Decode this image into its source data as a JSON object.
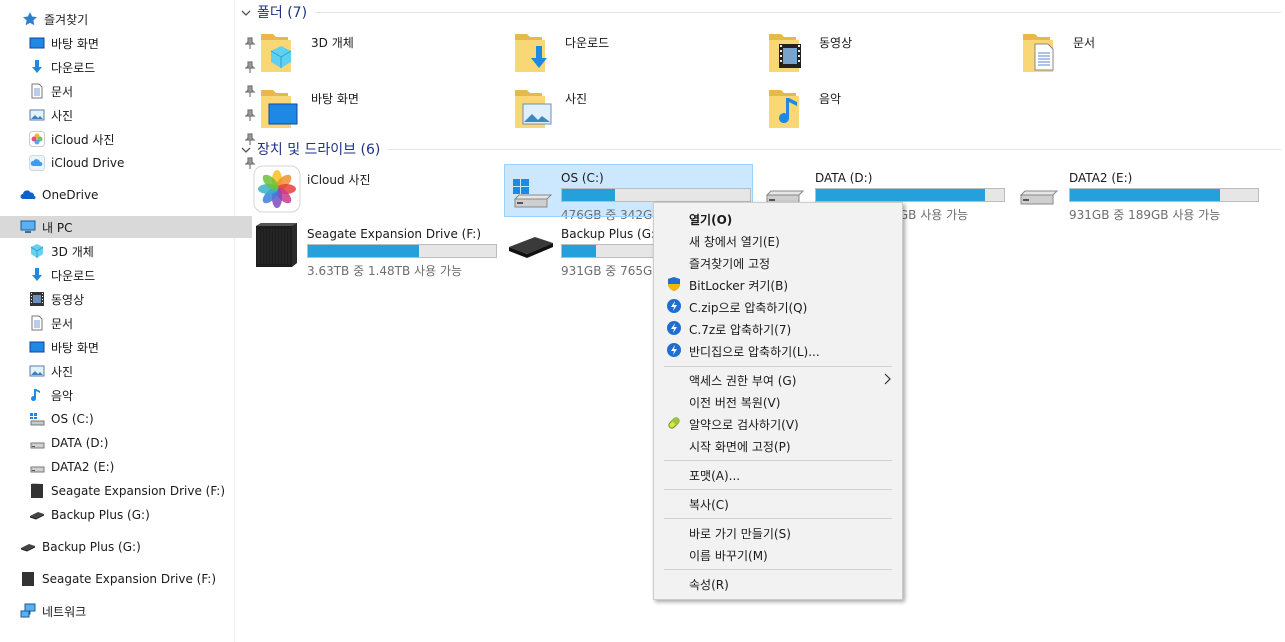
{
  "sidebar": {
    "favorites": "즐겨찾기",
    "quick": [
      {
        "label": "바탕 화면",
        "icon": "desktop-icon"
      },
      {
        "label": "다운로드",
        "icon": "download-icon"
      },
      {
        "label": "문서",
        "icon": "document-icon"
      },
      {
        "label": "사진",
        "icon": "pictures-icon"
      },
      {
        "label": "iCloud 사진",
        "icon": "icloud-photos-icon"
      },
      {
        "label": "iCloud Drive",
        "icon": "icloud-drive-icon"
      }
    ],
    "onedrive": "OneDrive",
    "thispc": "내 PC",
    "pc_items": [
      {
        "label": "3D 개체",
        "icon": "3d-objects-icon"
      },
      {
        "label": "다운로드",
        "icon": "download-icon"
      },
      {
        "label": "동영상",
        "icon": "videos-icon"
      },
      {
        "label": "문서",
        "icon": "document-icon"
      },
      {
        "label": "바탕 화면",
        "icon": "desktop-icon"
      },
      {
        "label": "사진",
        "icon": "pictures-icon"
      },
      {
        "label": "음악",
        "icon": "music-icon"
      },
      {
        "label": "OS (C:)",
        "icon": "os-drive-icon"
      },
      {
        "label": "DATA (D:)",
        "icon": "drive-icon"
      },
      {
        "label": "DATA2 (E:)",
        "icon": "drive-icon"
      },
      {
        "label": "Seagate Expansion Drive (F:)",
        "icon": "external-drive-icon"
      },
      {
        "label": "Backup Plus (G:)",
        "icon": "portable-drive-icon"
      }
    ],
    "backup": "Backup Plus (G:)",
    "seagate": "Seagate Expansion Drive (F:)",
    "network": "네트워크"
  },
  "main": {
    "folders_header": "폴더 (7)",
    "folders": [
      {
        "label": "3D 개체",
        "icon": "3d-objects-folder-icon"
      },
      {
        "label": "다운로드",
        "icon": "downloads-folder-icon"
      },
      {
        "label": "동영상",
        "icon": "videos-folder-icon"
      },
      {
        "label": "문서",
        "icon": "documents-folder-icon"
      },
      {
        "label": "바탕 화면",
        "icon": "desktop-folder-icon"
      },
      {
        "label": "사진",
        "icon": "pictures-folder-icon"
      },
      {
        "label": "음악",
        "icon": "music-folder-icon"
      }
    ],
    "devices_header": "장치 및 드라이브 (6)",
    "icloud": "iCloud 사진",
    "drives": [
      {
        "name": "OS (C:)",
        "free": "476GB 중 342GB 사용 가능",
        "used": 0.28
      },
      {
        "name": "DATA (D:)",
        "free": "1.81TB 중 185GB 사용 가능",
        "used": 0.9
      },
      {
        "name": "DATA2 (E:)",
        "free": "931GB 중 189GB 사용 가능",
        "used": 0.8
      },
      {
        "name": "Seagate Expansion Drive (F:)",
        "free": "3.63TB 중 1.48TB 사용 가능",
        "used": 0.59
      },
      {
        "name": "Backup Plus (G:)",
        "free": "931GB 중 765GB 사용 가능",
        "used": 0.18
      }
    ]
  },
  "context_menu": [
    {
      "label": "열기(O)"
    },
    {
      "label": "새 창에서 열기(E)"
    },
    {
      "label": "즐겨찾기에 고정"
    },
    {
      "label": "BitLocker 켜기(B)"
    },
    {
      "label": "C.zip으로 압축하기(Q)"
    },
    {
      "label": "C.7z로 압축하기(7)"
    },
    {
      "label": "반디집으로 압축하기(L)..."
    },
    {
      "label": "액세스 권한 부여 (G)"
    },
    {
      "label": "이전 버전 복원(V)"
    },
    {
      "label": "알약으로 검사하기(V)"
    },
    {
      "label": "시작 화면에 고정(P)"
    },
    {
      "label": "포맷(A)..."
    },
    {
      "label": "복사(C)"
    },
    {
      "label": "바로 가기 만들기(S)"
    },
    {
      "label": "이름 바꾸기(M)"
    },
    {
      "label": "속성(R)"
    }
  ],
  "colors": {
    "accent": "#26a0da",
    "header": "#1e3287",
    "selection": "#cce8ff"
  }
}
